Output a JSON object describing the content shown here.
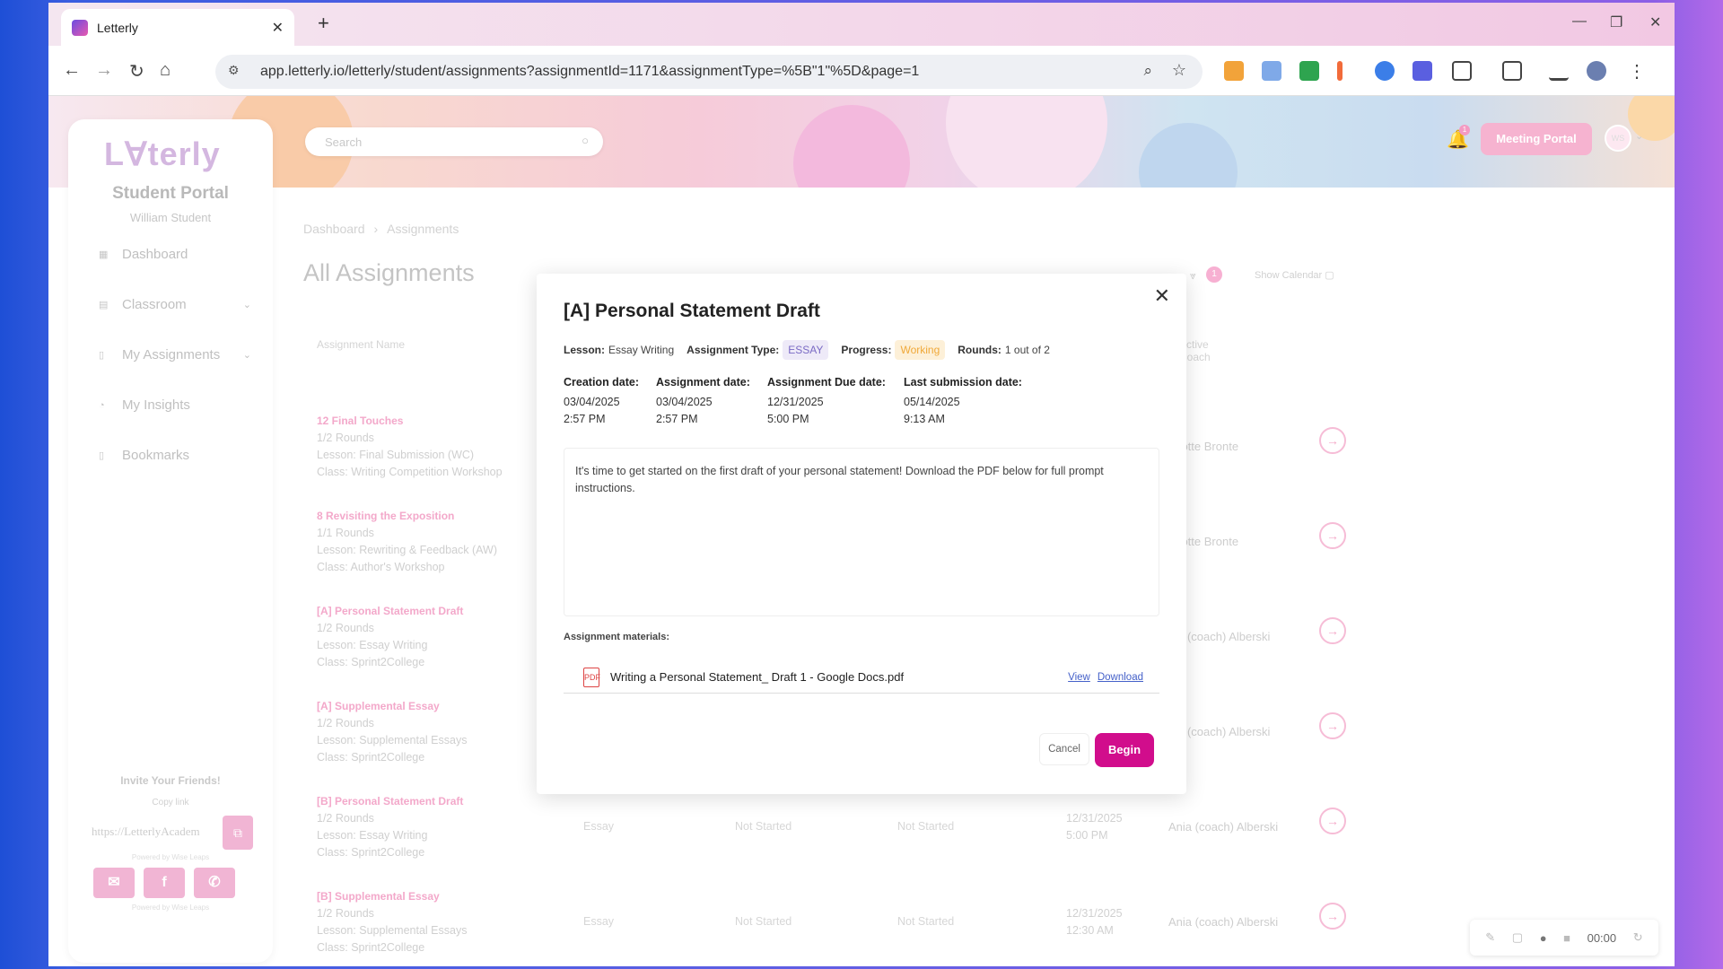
{
  "browser": {
    "tab_title": "Letterly",
    "url": "app.letterly.io/letterly/student/assignments?assignmentId=1171&assignmentType=%5B\"1\"%5D&page=1"
  },
  "sidebar": {
    "logo": "Lꓯterly",
    "portal": "Student Portal",
    "user": "William Student",
    "items": [
      {
        "label": "Dashboard",
        "icon": "grid-icon"
      },
      {
        "label": "Classroom",
        "icon": "book-icon"
      },
      {
        "label": "My Assignments",
        "icon": "doc-icon"
      },
      {
        "label": "My Insights",
        "icon": "chart-icon"
      },
      {
        "label": "Bookmarks",
        "icon": "bookmark-icon"
      }
    ],
    "invite_title": "Invite Your Friends!",
    "copy_link": "Copy link",
    "invite_link": "https://LetterlyAcadem",
    "powered": "Powered by Wise Leaps"
  },
  "header": {
    "search_placeholder": "Search",
    "bell_count": "1",
    "meeting_label": "Meeting Portal",
    "avatar_initials": "WS"
  },
  "main": {
    "breadcrumb": [
      "Dashboard",
      "Assignments"
    ],
    "title": "All Assignments",
    "filter_count": "1",
    "show_calendar": "Show Calendar",
    "col_name": "Assignment Name",
    "col_coach": "Active Coach",
    "rows": [
      {
        "name": "12 Final Touches",
        "rounds": "1/2 Rounds",
        "lesson": "Lesson: Final Submission (WC)",
        "class": "Class: Writing Competition Workshop",
        "type": "",
        "status1": "",
        "status2": "",
        "due_date": "",
        "due_time": "",
        "coach": "arlotte Bronte"
      },
      {
        "name": "8 Revisiting the Exposition",
        "rounds": "1/1 Rounds",
        "lesson": "Lesson: Rewriting & Feedback (AW)",
        "class": "Class: Author's Workshop",
        "type": "",
        "status1": "",
        "status2": "",
        "due_date": "",
        "due_time": "",
        "coach": "arlotte Bronte"
      },
      {
        "name": "[A] Personal Statement Draft",
        "rounds": "1/2 Rounds",
        "lesson": "Lesson: Essay Writing",
        "class": "Class: Sprint2College",
        "type": "",
        "status1": "",
        "status2": "",
        "due_date": "",
        "due_time": "",
        "coach": "nia (coach) Alberski"
      },
      {
        "name": "[A] Supplemental Essay",
        "rounds": "1/2 Rounds",
        "lesson": "Lesson: Supplemental Essays",
        "class": "Class: Sprint2College",
        "type": "",
        "status1": "",
        "status2": "",
        "due_date": "",
        "due_time": "",
        "coach": "nia (coach) Alberski"
      },
      {
        "name": "[B] Personal Statement Draft",
        "rounds": "1/2 Rounds",
        "lesson": "Lesson: Essay Writing",
        "class": "Class: Sprint2College",
        "type": "Essay",
        "status1": "Not Started",
        "status2": "Not Started",
        "due_date": "12/31/2025",
        "due_time": "5:00 PM",
        "coach": "Ania (coach) Alberski"
      },
      {
        "name": "[B] Supplemental Essay",
        "rounds": "1/2 Rounds",
        "lesson": "Lesson: Supplemental Essays",
        "class": "Class: Sprint2College",
        "type": "Essay",
        "status1": "Not Started",
        "status2": "Not Started",
        "due_date": "12/31/2025",
        "due_time": "12:30 AM",
        "coach": "Ania (coach) Alberski"
      }
    ]
  },
  "modal": {
    "title": "[A] Personal Statement Draft",
    "lesson_label": "Lesson:",
    "lesson_value": "Essay Writing",
    "type_label": "Assignment Type:",
    "type_value": "ESSAY",
    "progress_label": "Progress:",
    "progress_value": "Working",
    "rounds_label": "Rounds:",
    "rounds_value": "1 out of 2",
    "dates": [
      {
        "label": "Creation date:",
        "date": "03/04/2025",
        "time": "2:57 PM"
      },
      {
        "label": "Assignment date:",
        "date": "03/04/2025",
        "time": "2:57 PM"
      },
      {
        "label": "Assignment Due date:",
        "date": "12/31/2025",
        "time": "5:00 PM"
      },
      {
        "label": "Last submission date:",
        "date": "05/14/2025",
        "time": "9:13 AM"
      }
    ],
    "description": "It's time to get started on the first draft of your personal statement! Download the PDF below for full prompt instructions.",
    "materials_label": "Assignment materials:",
    "file_name": "Writing a Personal Statement_ Draft 1 - Google Docs.pdf",
    "view": "View",
    "download": "Download",
    "cancel": "Cancel",
    "begin": "Begin"
  },
  "recorder": {
    "time": "00:00"
  }
}
